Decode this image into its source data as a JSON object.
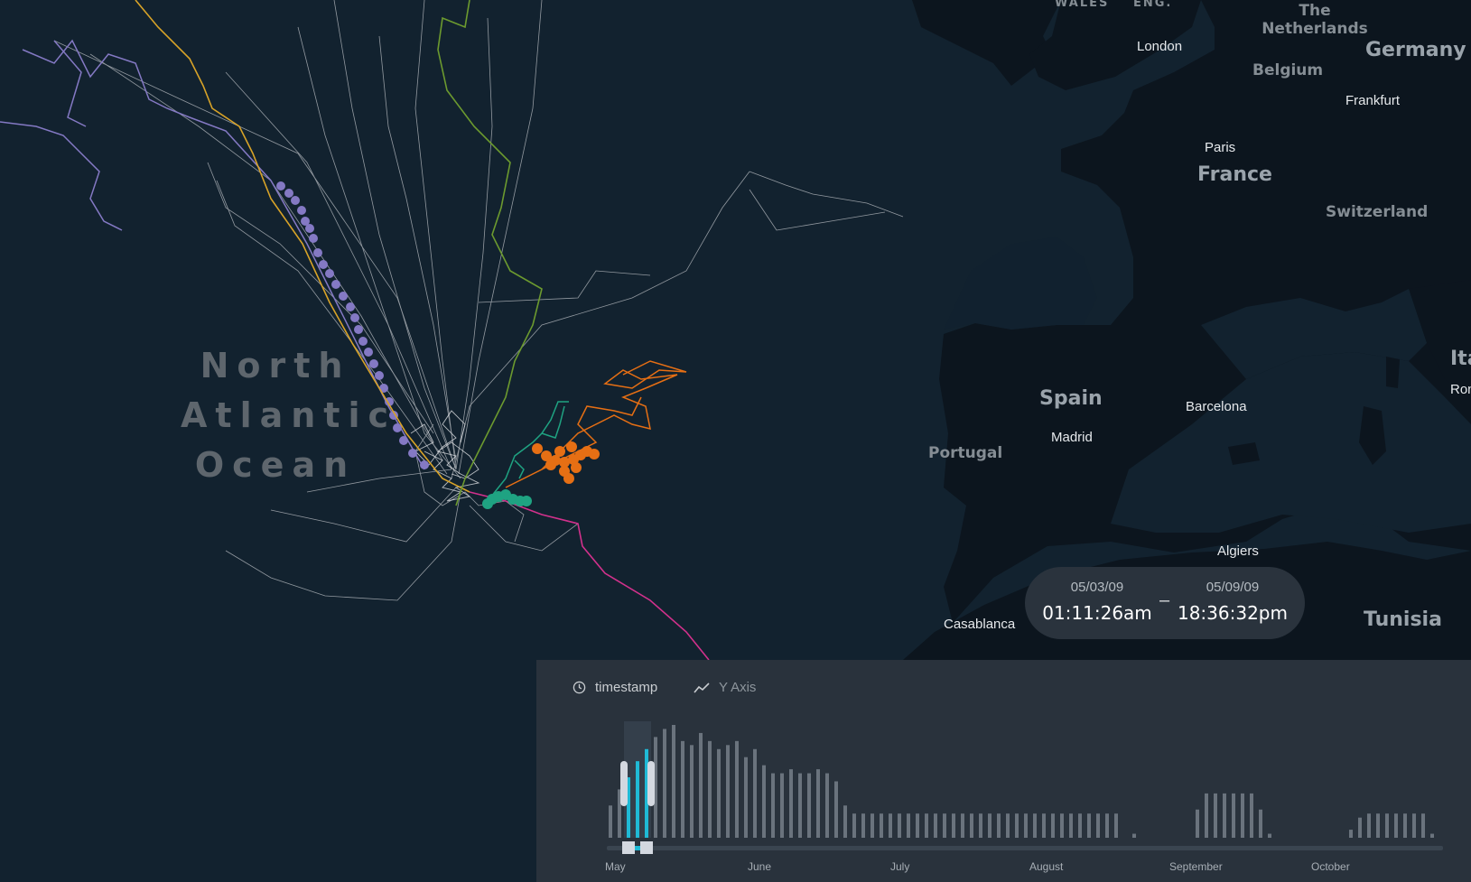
{
  "map": {
    "ocean_label_lines": [
      "North",
      "Atlantic",
      "Ocean"
    ],
    "countries": [
      {
        "name": "Germany"
      },
      {
        "name": "France"
      },
      {
        "name": "Spain"
      },
      {
        "name": "Tunisia"
      },
      {
        "name": "Portugal"
      },
      {
        "name": "Belgium"
      },
      {
        "name": "Switzerland"
      },
      {
        "name": "The Netherlands"
      },
      {
        "name": "Ita"
      },
      {
        "name": "WALES"
      },
      {
        "name": "ENG."
      }
    ],
    "cities": [
      "London",
      "Frankfurt",
      "Paris",
      "Madrid",
      "Barcelona",
      "Algiers",
      "Casablanca",
      "Ron"
    ],
    "colors": {
      "ocean": "#12222f",
      "land": "#0c151e",
      "track_white": "#c9ccd0",
      "purple": "#8479c4",
      "yellow": "#d8a328",
      "green": "#6c9a2f",
      "teal": "#1fa382",
      "orange": "#e66f14",
      "magenta": "#d2318c"
    }
  },
  "time_range": {
    "start_date": "05/03/09",
    "start_time": "01:11:26am",
    "separator": "–",
    "end_date": "05/09/09",
    "end_time": "18:36:32pm"
  },
  "panel": {
    "tab_timestamp": "timestamp",
    "tab_timestamp_icon": "clock-icon",
    "tab_yaxis": "Y Axis",
    "tab_yaxis_icon": "trend-line-icon",
    "month_labels": [
      "May",
      "June",
      "July",
      "August",
      "September",
      "October"
    ],
    "colors": {
      "bar": "#6a737d",
      "bar_selected": "#1fbad6",
      "track": "#3a4550",
      "handle": "#d3d8e0"
    }
  },
  "chart_data": {
    "type": "bar",
    "title": "",
    "xlabel": "timestamp",
    "ylabel": "",
    "categories": [
      "May",
      "June",
      "July",
      "August",
      "September",
      "October"
    ],
    "values": [
      8,
      12,
      15,
      19,
      22,
      25,
      27,
      28,
      24,
      23,
      26,
      24,
      22,
      23,
      24,
      20,
      22,
      18,
      16,
      16,
      17,
      16,
      16,
      17,
      16,
      14,
      8,
      6,
      6,
      6,
      6,
      6,
      6,
      6,
      6,
      6,
      6,
      6,
      6,
      6,
      6,
      6,
      6,
      6,
      6,
      6,
      6,
      6,
      6,
      6,
      6,
      6,
      6,
      6,
      6,
      6,
      6,
      0,
      1,
      0,
      0,
      0,
      0,
      0,
      0,
      7,
      11,
      11,
      11,
      11,
      11,
      11,
      7,
      1,
      0,
      0,
      0,
      0,
      0,
      0,
      0,
      0,
      2,
      5,
      6,
      6,
      6,
      6,
      6,
      6,
      6,
      1
    ],
    "selected_range_indices": [
      2,
      4
    ],
    "bar_color": "#6a737d",
    "selected_color": "#1fbad6"
  }
}
